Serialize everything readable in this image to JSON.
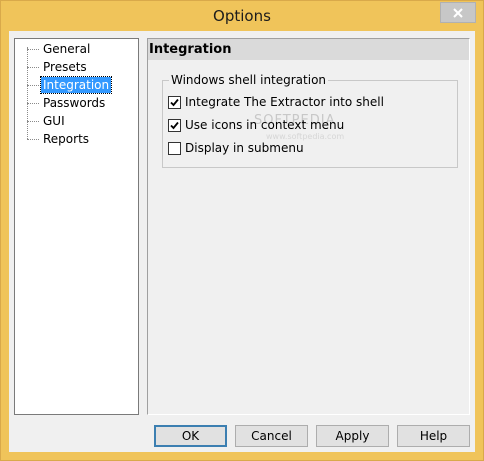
{
  "window": {
    "title": "Options",
    "close_icon": "close-icon"
  },
  "tree": {
    "items": [
      {
        "label": "General",
        "selected": false
      },
      {
        "label": "Presets",
        "selected": false
      },
      {
        "label": "Integration",
        "selected": true
      },
      {
        "label": "Passwords",
        "selected": false
      },
      {
        "label": "GUI",
        "selected": false
      },
      {
        "label": "Reports",
        "selected": false
      }
    ]
  },
  "panel": {
    "header": "Integration",
    "group_label": "Windows shell integration",
    "options": [
      {
        "label": "Integrate The Extractor into shell",
        "checked": true
      },
      {
        "label": "Use icons in context menu",
        "checked": true
      },
      {
        "label": "Display in submenu",
        "checked": false
      }
    ]
  },
  "buttons": {
    "ok": "OK",
    "cancel": "Cancel",
    "apply": "Apply",
    "help": "Help"
  },
  "watermark": {
    "main": "SOFTPEDIA",
    "small": "www.softpedia.com"
  },
  "colors": {
    "titlebar": "#f0c45a",
    "selection": "#3399ff",
    "client": "#f0f0f0"
  }
}
